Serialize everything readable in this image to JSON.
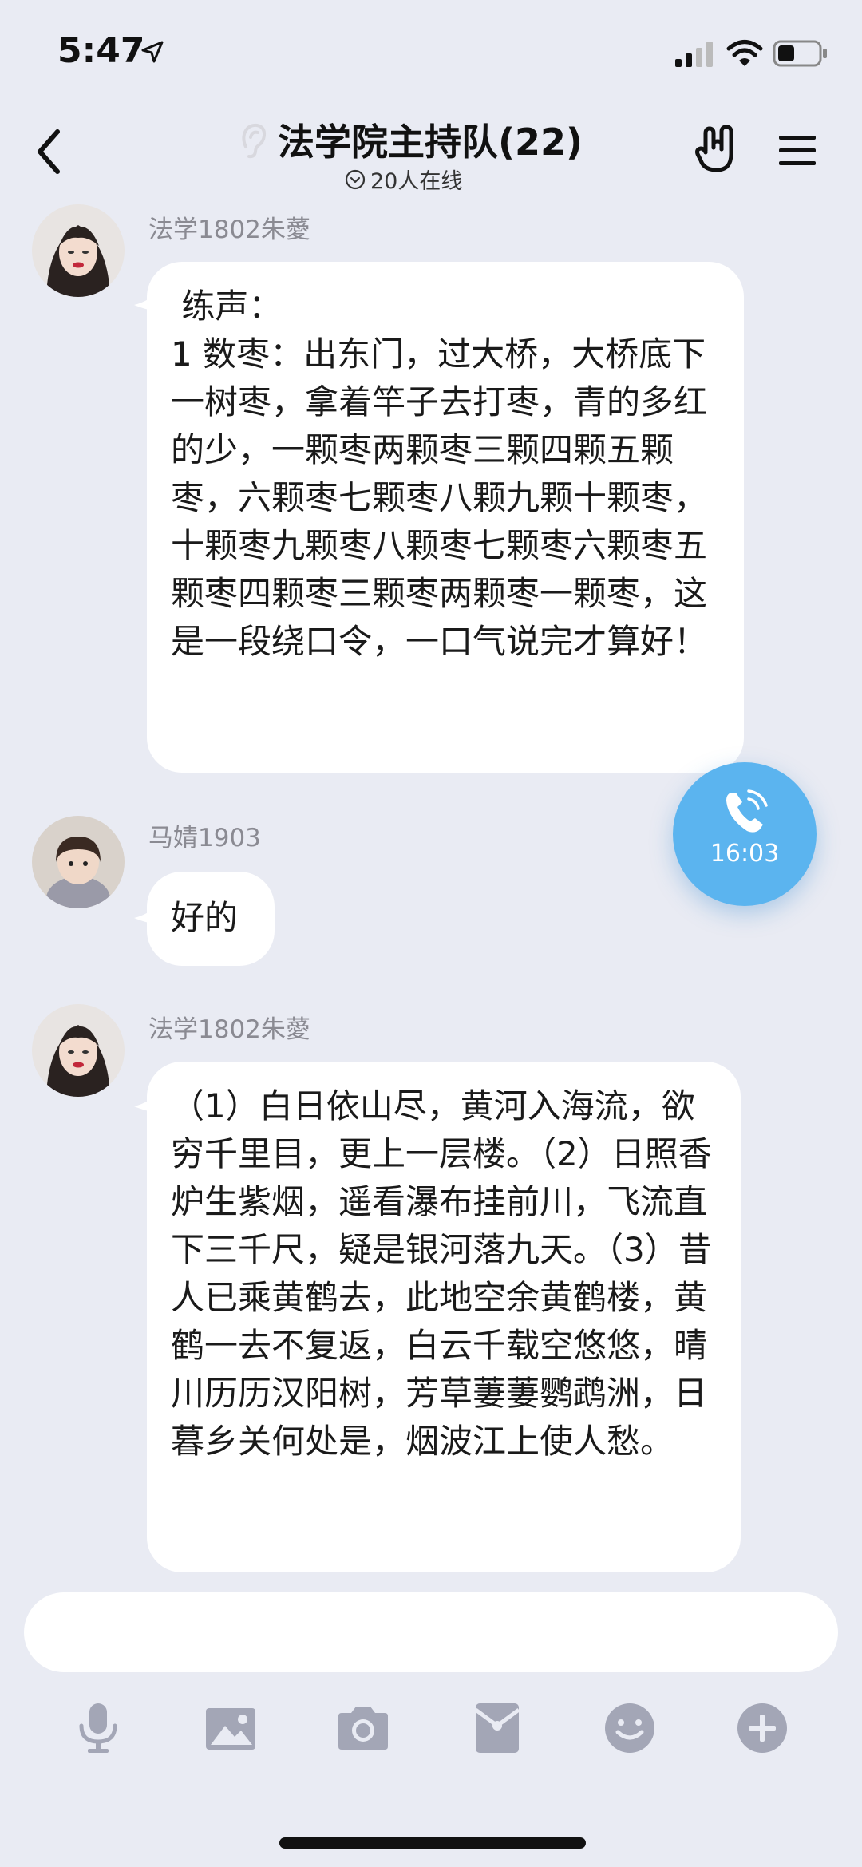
{
  "status_bar": {
    "time": "5:47"
  },
  "header": {
    "title": "法学院主持队(22)",
    "online": "20人在线"
  },
  "messages": [
    {
      "sender": "法学1802朱薆",
      "text": " 练声：\n1 数枣：出东门，过大桥，大桥底下一树枣，拿着竿子去打枣，青的多红的少，一颗枣两颗枣三颗四颗五颗枣，六颗枣七颗枣八颗九颗十颗枣，十颗枣九颗枣八颗枣七颗枣六颗枣五颗枣四颗枣三颗枣两颗枣一颗枣，这是一段绕口令，一口气说完才算好！"
    },
    {
      "sender": "马婧1903",
      "text": "好的"
    },
    {
      "sender": "法学1802朱薆",
      "text": "（1）白日依山尽，黄河入海流，欲穷千里目，更上一层楼。（2）日照香炉生紫烟，遥看瀑布挂前川，飞流直下三千尺，疑是银河落九天。（3）昔人已乘黄鹤去，此地空余黄鹤楼，黄鹤一去不复返，白云千载空悠悠，晴川历历汉阳树，芳草萋萋鹦鹉洲，日暮乡关何处是，烟波江上使人愁。"
    }
  ],
  "call": {
    "duration": "16:03"
  },
  "input": {
    "placeholder": ""
  },
  "toolbar": {
    "icons": [
      "microphone-icon",
      "image-icon",
      "camera-icon",
      "red-packet-icon",
      "emoji-icon",
      "plus-icon"
    ]
  },
  "colors": {
    "accent": "#5bb4ef",
    "background": "#e9ebf3",
    "icon_gray": "#a3a6b6"
  }
}
